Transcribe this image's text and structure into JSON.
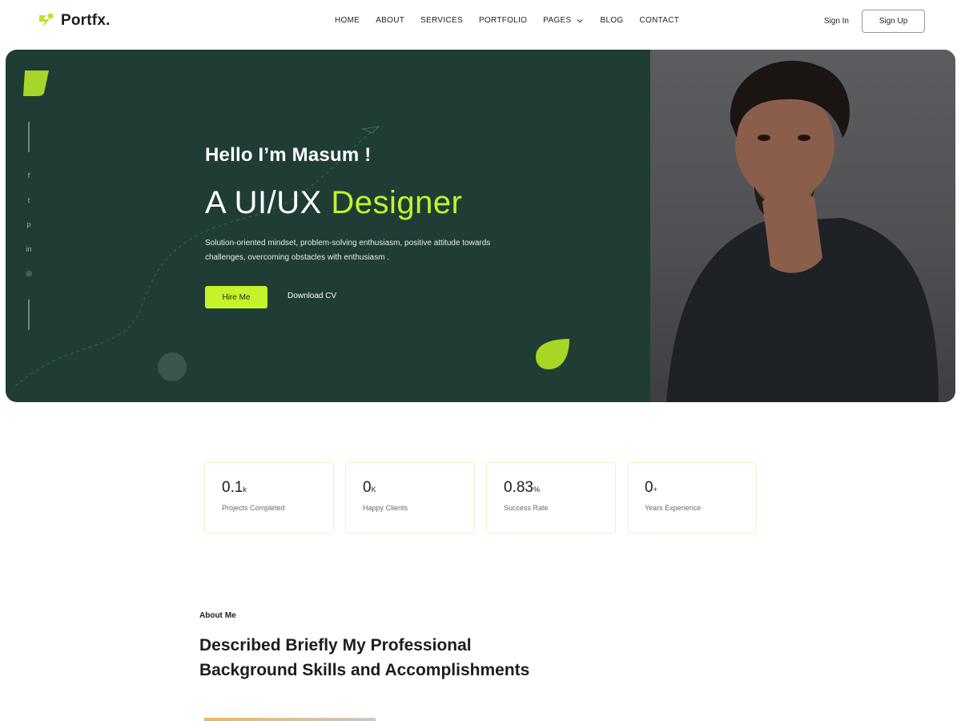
{
  "brand": {
    "name": "Portfx.",
    "accent": "#c4f22b",
    "dark": "#1f3d34"
  },
  "nav": {
    "items": [
      {
        "label": "HOME"
      },
      {
        "label": "ABOUT"
      },
      {
        "label": "SERVICES"
      },
      {
        "label": "PORTFOLIO"
      },
      {
        "label": "PAGES",
        "icon": "chevron-down-icon"
      },
      {
        "label": "BLOG"
      },
      {
        "label": "CONTACT"
      }
    ],
    "signin": "Sign In",
    "signup": "Sign Up"
  },
  "hero": {
    "greeting": "Hello I’m Masum !",
    "title_prefix": "A UI/UX ",
    "title_accent": "Designer",
    "description": "Solution-oriented mindset, problem-solving enthusiasm, positive attitude towards challenges, overcoming obstacles with enthusiasm .",
    "hire_button": "Hire Me",
    "cv_button": "Download CV",
    "social_icons": [
      "facebook-icon",
      "twitter-icon",
      "pinterest-icon",
      "linkedin-icon",
      "dribbble-icon"
    ]
  },
  "stats": [
    {
      "value": "0.1",
      "suffix": "k",
      "label": "Projects Completed"
    },
    {
      "value": "0",
      "suffix": "K",
      "label": "Happy Clients"
    },
    {
      "value": "0.83",
      "suffix": "%",
      "label": "Success Rate"
    },
    {
      "value": "0",
      "suffix": "+",
      "label": "Years Experience"
    }
  ],
  "about": {
    "tag_prefix": "About ",
    "tag_highlight": "Me",
    "heading": "Described Briefly My Professional Background Skills and Accomplishments"
  }
}
